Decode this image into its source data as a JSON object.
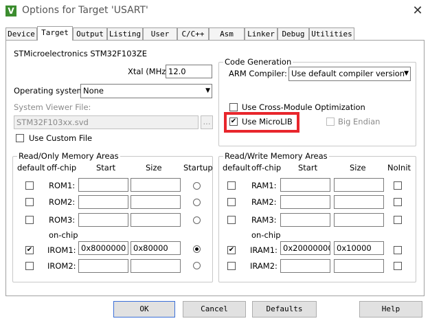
{
  "window": {
    "title": "Options for Target 'USART'",
    "close": "✕",
    "app_icon": "keil-uvision-icon"
  },
  "tabs": [
    {
      "label": "Device"
    },
    {
      "label": "Target",
      "active": true
    },
    {
      "label": "Output"
    },
    {
      "label": "Listing"
    },
    {
      "label": "User"
    },
    {
      "label": "C/C++"
    },
    {
      "label": "Asm"
    },
    {
      "label": "Linker"
    },
    {
      "label": "Debug"
    },
    {
      "label": "Utilities"
    }
  ],
  "target": {
    "device_name": "STMicroelectronics STM32F103ZE",
    "xtal_label": "Xtal (MHz):",
    "xtal_value": "12.0",
    "os_label": "Operating system:",
    "os_value": "None",
    "svd_label": "System Viewer File:",
    "svd_value": "STM32F103xx.svd",
    "svd_browse": "...",
    "custom_file_label": "Use Custom File",
    "custom_file_checked": false
  },
  "code_gen": {
    "title": "Code Generation",
    "compiler_label": "ARM Compiler:",
    "compiler_value": "Use default compiler version",
    "cross_module_label": "Use Cross-Module Optimization",
    "cross_module_checked": false,
    "microlib_label": "Use MicroLIB",
    "microlib_checked": true,
    "big_endian_label": "Big Endian",
    "big_endian_checked": false
  },
  "ro_mem": {
    "title": "Read/Only Memory Areas",
    "headers": {
      "default": "default",
      "offchip": "off-chip",
      "start": "Start",
      "size": "Size",
      "last": "Startup"
    },
    "onchip_label": "on-chip",
    "rows": [
      {
        "name": "ROM1:",
        "default": false,
        "start": "",
        "size": "",
        "selected": false
      },
      {
        "name": "ROM2:",
        "default": false,
        "start": "",
        "size": "",
        "selected": false
      },
      {
        "name": "ROM3:",
        "default": false,
        "start": "",
        "size": "",
        "selected": false
      },
      {
        "name": "IROM1:",
        "default": true,
        "start": "0x8000000",
        "size": "0x80000",
        "selected": true
      },
      {
        "name": "IROM2:",
        "default": false,
        "start": "",
        "size": "",
        "selected": false
      }
    ]
  },
  "rw_mem": {
    "title": "Read/Write Memory Areas",
    "headers": {
      "default": "default",
      "offchip": "off-chip",
      "start": "Start",
      "size": "Size",
      "last": "NoInit"
    },
    "onchip_label": "on-chip",
    "rows": [
      {
        "name": "RAM1:",
        "default": false,
        "start": "",
        "size": "",
        "noinit": false
      },
      {
        "name": "RAM2:",
        "default": false,
        "start": "",
        "size": "",
        "noinit": false
      },
      {
        "name": "RAM3:",
        "default": false,
        "start": "",
        "size": "",
        "noinit": false
      },
      {
        "name": "IRAM1:",
        "default": true,
        "start": "0x20000000",
        "size": "0x10000",
        "noinit": false
      },
      {
        "name": "IRAM2:",
        "default": false,
        "start": "",
        "size": "",
        "noinit": false
      }
    ]
  },
  "buttons": {
    "ok": "OK",
    "cancel": "Cancel",
    "defaults": "Defaults",
    "help": "Help"
  },
  "highlight_color": "#e8262c"
}
